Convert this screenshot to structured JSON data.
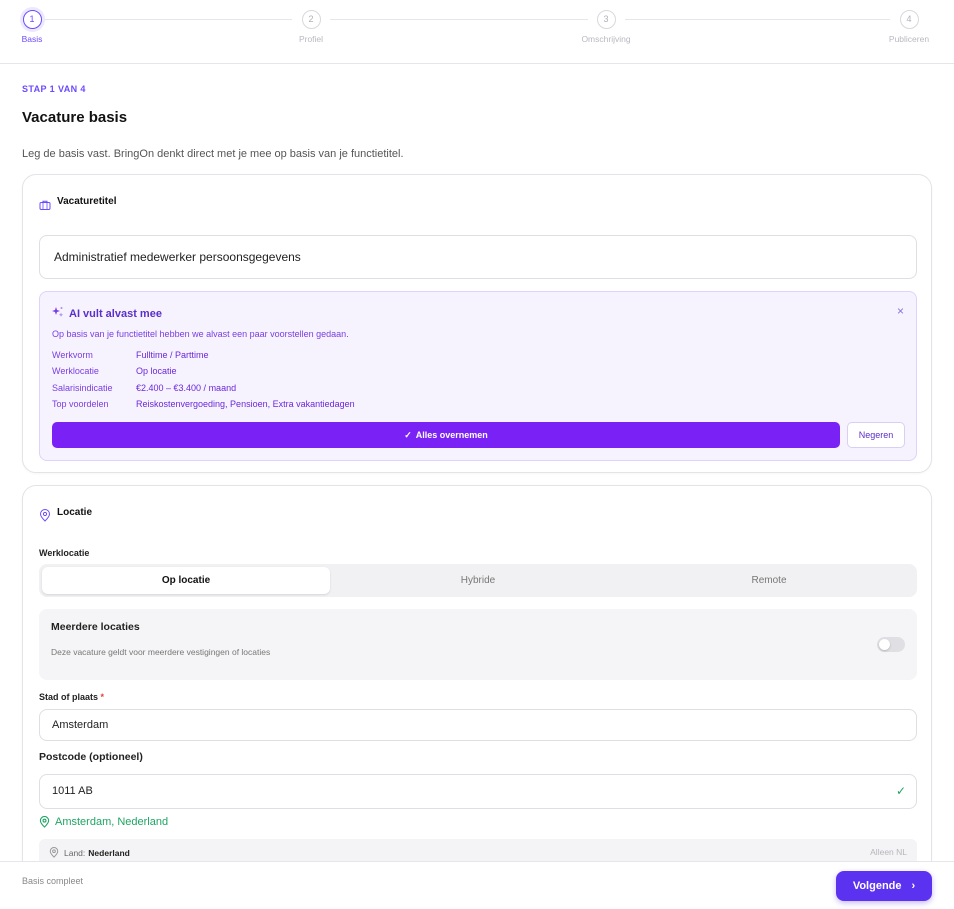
{
  "stepper": {
    "steps": [
      {
        "number": "1",
        "label": "Basis"
      },
      {
        "number": "2",
        "label": "Profiel"
      },
      {
        "number": "3",
        "label": "Omschrijving"
      },
      {
        "number": "4",
        "label": "Publiceren"
      }
    ]
  },
  "header": {
    "eyebrow": "STAP 1 VAN 4",
    "title": "Vacature basis",
    "intro": "Leg de basis vast. BringOn denkt direct met je mee op basis van je functietitel."
  },
  "job_title_card": {
    "title": "Vacaturetitel",
    "input_value": "Administratief medewerker persoonsgegevens",
    "ai": {
      "title": "AI vult alvast mee",
      "description": "Op basis van je functietitel hebben we alvast een paar voorstellen gedaan.",
      "rows": [
        {
          "key": "Werkvorm",
          "value": "Fulltime / Parttime"
        },
        {
          "key": "Werklocatie",
          "value": "Op locatie"
        },
        {
          "key": "Salarisindicatie",
          "value": "€2.400 – €3.400 / maand"
        },
        {
          "key": "Top voordelen",
          "value": "Reiskostenvergoeding, Pensioen, Extra vakantiedagen"
        }
      ],
      "accept_label": "Alles overnemen",
      "ignore_label": "Negeren",
      "close_symbol": "×"
    }
  },
  "location_card": {
    "title": "Locatie",
    "worklocation_label": "Werklocatie",
    "segments": [
      "Op locatie",
      "Hybride",
      "Remote"
    ],
    "selected_segment": "Op locatie",
    "multi": {
      "title": "Meerdere locaties",
      "description": "Deze vacature geldt voor meerdere vestigingen of locaties",
      "enabled": false
    },
    "city_label": "Stad of plaats",
    "city_required": "*",
    "city_value": "Amsterdam",
    "postcode_label": "Postcode (optioneel)",
    "postcode_value": "1011 AB",
    "resolved": "Amsterdam, Nederland",
    "country_label": "Land:",
    "country_value": "Nederland",
    "country_note": "Alleen NL"
  },
  "footer": {
    "status": "Basis compleet",
    "next_label": "Volgende"
  },
  "colors": {
    "accent": "#6d4aff",
    "ai_button": "#7a22f5",
    "next_button": "#5b32ef",
    "success": "#1fa463"
  }
}
